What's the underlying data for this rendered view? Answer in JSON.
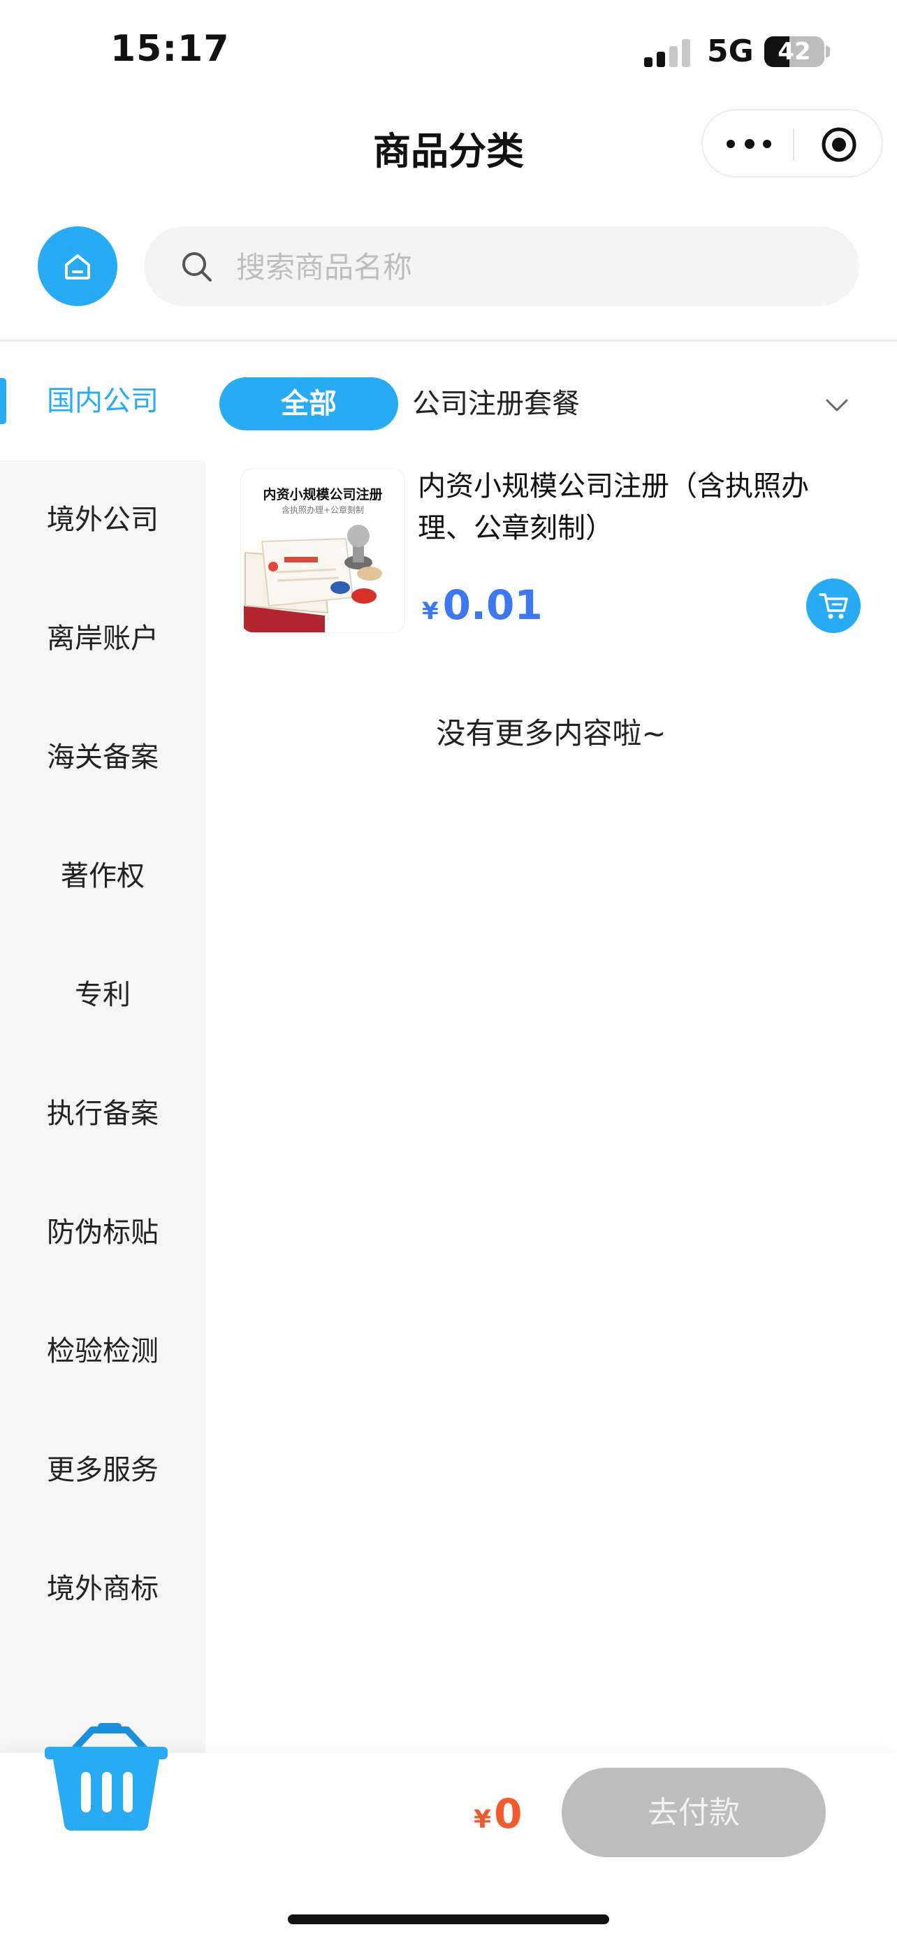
{
  "status_bar": {
    "time": "15:17",
    "network": "5G",
    "battery_percent": "42",
    "battery_level": 0.42
  },
  "nav": {
    "title": "商品分类"
  },
  "search": {
    "placeholder": "搜索商品名称"
  },
  "sidebar": {
    "items": [
      {
        "label": "国内公司",
        "active": true
      },
      {
        "label": "境外公司"
      },
      {
        "label": "离岸账户"
      },
      {
        "label": "海关备案"
      },
      {
        "label": "著作权"
      },
      {
        "label": "专利"
      },
      {
        "label": "执行备案"
      },
      {
        "label": "防伪标贴"
      },
      {
        "label": "检验检测"
      },
      {
        "label": "更多服务"
      },
      {
        "label": "境外商标"
      }
    ]
  },
  "filters": {
    "all_label": "全部",
    "category_label": "公司注册套餐"
  },
  "products": [
    {
      "name": "内资小规模公司注册（含执照办理、公章刻制）",
      "currency": "¥",
      "price": "0.01",
      "image_title": "内资小规模公司注册",
      "image_subtitle": "含执照办理+公章刻制"
    }
  ],
  "list_end_text": "没有更多内容啦~",
  "footer": {
    "currency": "¥",
    "total": "0",
    "pay_label": "去付款"
  },
  "colors": {
    "accent": "#29abf4",
    "price": "#3d78f2",
    "total": "#f05a2d",
    "pay_disabled": "#bdbdbd"
  }
}
